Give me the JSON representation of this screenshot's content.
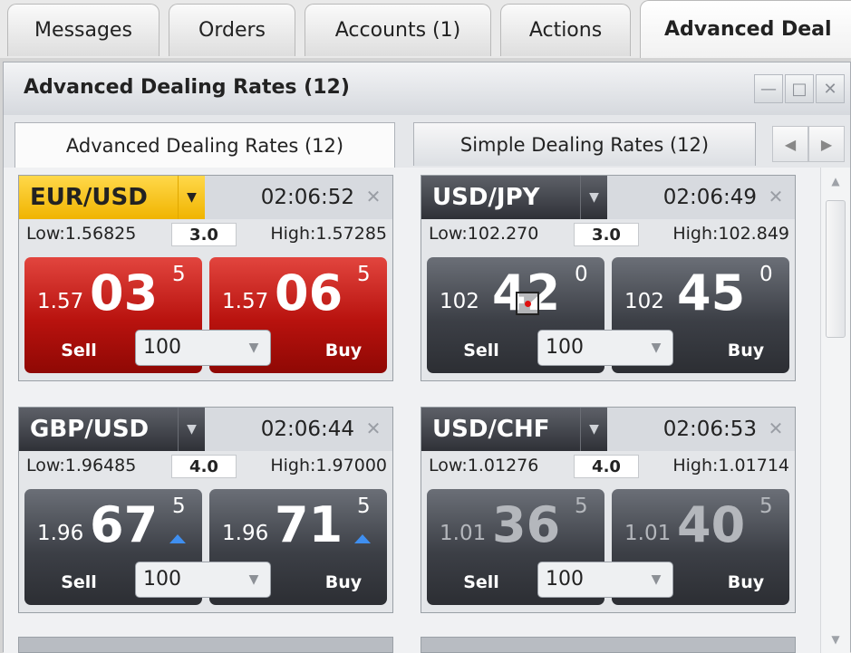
{
  "top_tabs": [
    "Messages",
    "Orders",
    "Accounts (1)",
    "Actions",
    "Advanced Deal"
  ],
  "window": {
    "title": "Advanced Dealing Rates (12)",
    "minimize_icon": "minimize-icon",
    "maximize_icon": "maximize-icon",
    "close_icon": "close-icon"
  },
  "inner_tabs": [
    "Advanced Dealing Rates (12)",
    "Simple Dealing Rates (12)"
  ],
  "tiles": [
    {
      "symbol": "EUR/USD",
      "time": "02:06:52",
      "low_label": "Low:",
      "low": "1.56825",
      "spread": "3.0",
      "high_label": "High:",
      "high": "1.57285",
      "sell": {
        "pre": "1.57",
        "big": "03",
        "pip": "5",
        "label": "Sell"
      },
      "buy": {
        "pre": "1.57",
        "big": "06",
        "pip": "5",
        "label": "Buy"
      },
      "qty": "100",
      "theme": "red"
    },
    {
      "symbol": "USD/JPY",
      "time": "02:06:49",
      "low_label": "Low:",
      "low": "102.270",
      "spread": "3.0",
      "high_label": "High:",
      "high": "102.849",
      "sell": {
        "pre": "102",
        "big": "42",
        "pip": "0",
        "label": "Sell"
      },
      "buy": {
        "pre": "102",
        "big": "45",
        "pip": "0",
        "label": "Buy"
      },
      "qty": "100",
      "theme": "dark"
    },
    {
      "symbol": "GBP/USD",
      "time": "02:06:44",
      "low_label": "Low:",
      "low": "1.96485",
      "spread": "4.0",
      "high_label": "High:",
      "high": "1.97000",
      "sell": {
        "pre": "1.96",
        "big": "67",
        "pip": "5",
        "label": "Sell"
      },
      "buy": {
        "pre": "1.96",
        "big": "71",
        "pip": "5",
        "label": "Buy"
      },
      "qty": "100",
      "theme": "dark"
    },
    {
      "symbol": "USD/CHF",
      "time": "02:06:53",
      "low_label": "Low:",
      "low": "1.01276",
      "spread": "4.0",
      "high_label": "High:",
      "high": "1.01714",
      "sell": {
        "pre": "1.01",
        "big": "36",
        "pip": "5",
        "label": "Sell"
      },
      "buy": {
        "pre": "1.01",
        "big": "40",
        "pip": "5",
        "label": "Buy"
      },
      "qty": "100",
      "theme": "dim"
    }
  ],
  "colors": {
    "yellow_symbol": "#f0b400",
    "sell_red": "#b8120e",
    "dark_button": "#3c3f46",
    "uptick": "#3f8ff0"
  }
}
